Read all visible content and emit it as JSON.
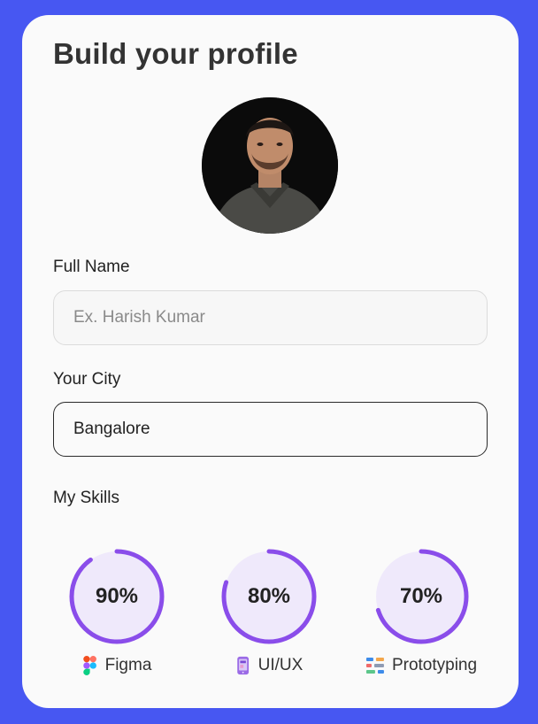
{
  "page": {
    "title": "Build your profile"
  },
  "profile": {
    "avatar_icon": "person-portrait"
  },
  "form": {
    "full_name_label": "Full Name",
    "full_name_placeholder": "Ex. Harish Kumar",
    "full_name_value": "",
    "city_label": "Your City",
    "city_value": "Bangalore"
  },
  "skills": {
    "heading": "My Skills",
    "ring_color": "#8a4dea",
    "ring_fill": "#efe9fb",
    "items": [
      {
        "name": "Figma",
        "percent": 90,
        "percent_label": "90%",
        "icon": "figma-icon"
      },
      {
        "name": "UI/UX",
        "percent": 80,
        "percent_label": "80%",
        "icon": "phone-design-icon"
      },
      {
        "name": "Prototyping",
        "percent": 70,
        "percent_label": "70%",
        "icon": "prototype-icon"
      }
    ]
  },
  "colors": {
    "background": "#4757f2",
    "card": "#fafafa",
    "text": "#333333"
  }
}
